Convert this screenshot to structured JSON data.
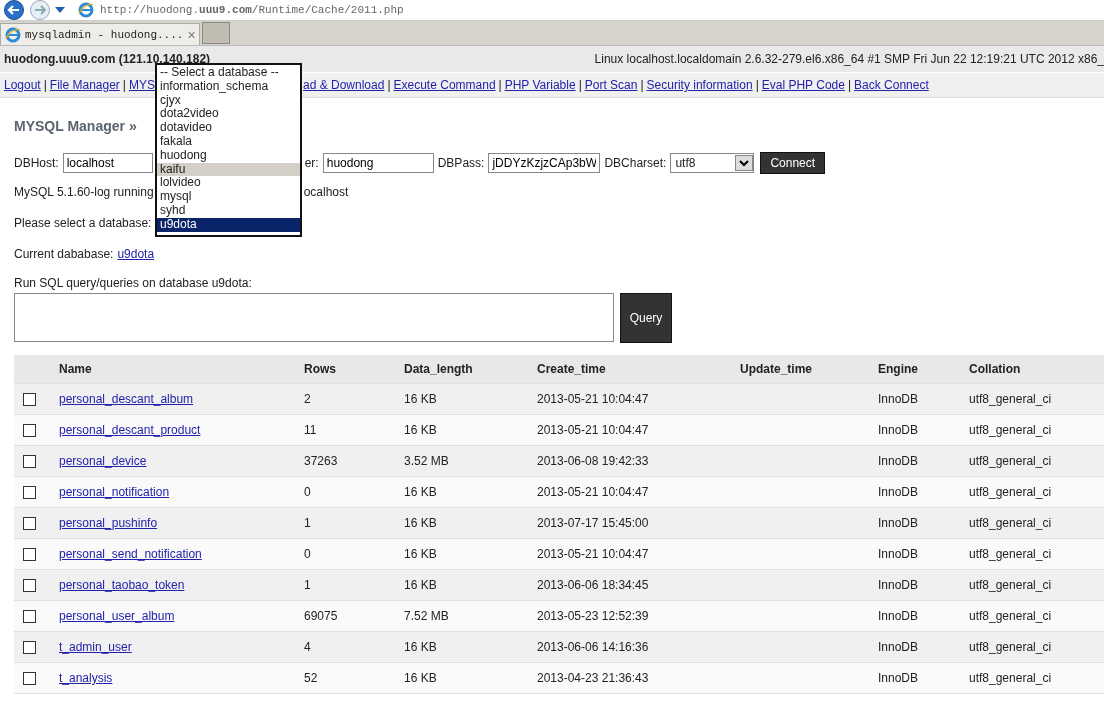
{
  "browser": {
    "url": "http://huodong.**uuu9.com**/Runtime/Cache/2011.php",
    "tab_title": "mysqladmin - huodong....",
    "tab_close": "×"
  },
  "header": {
    "host": "huodong.uuu9.com (121.10.140.182)",
    "system": "Linux localhost.localdomain 2.6.32-279.el6.x86_64 #1 SMP Fri Jun 22 12:19:21 UTC 2012 x86_"
  },
  "nav": [
    {
      "kind": "link",
      "label": "Logout"
    },
    {
      "kind": "separator",
      "label": "|"
    },
    {
      "kind": "link",
      "label": "File Manager"
    },
    {
      "kind": "separator",
      "label": "|"
    },
    {
      "kind": "link",
      "label": "MYS"
    },
    {
      "kind": "covered"
    },
    {
      "kind": "link",
      "label": "ad & Download"
    },
    {
      "kind": "separator",
      "label": "|"
    },
    {
      "kind": "link",
      "label": "Execute Command"
    },
    {
      "kind": "separator",
      "label": "|"
    },
    {
      "kind": "link",
      "label": "PHP Variable"
    },
    {
      "kind": "separator",
      "label": "|"
    },
    {
      "kind": "link",
      "label": "Port Scan"
    },
    {
      "kind": "separator",
      "label": "|"
    },
    {
      "kind": "link",
      "label": "Security information"
    },
    {
      "kind": "separator",
      "label": "|"
    },
    {
      "kind": "link",
      "label": "Eval PHP Code"
    },
    {
      "kind": "separator",
      "label": "|"
    },
    {
      "kind": "link",
      "label": "Back Connect"
    }
  ],
  "title": "MYSQL Manager »",
  "connect": {
    "host_label": "DBHost:",
    "host": "localhost",
    "user_label": "er:",
    "user": "huodong",
    "pass_label": "DBPass:",
    "pass": "jDDYzKzjzCAp3bW",
    "charset_label": "DBCharset:",
    "charset": "utf8",
    "button": "Connect"
  },
  "server_info": {
    "left": "MySQL 5.1.60-log running",
    "right": "ocalhost"
  },
  "select_label": "Please select a database:",
  "current": {
    "label": "Current dababase:",
    "database": "u9dota"
  },
  "query": {
    "label": "Run SQL query/queries on database u9dota:",
    "button": "Query"
  },
  "database_dropdown": [
    {
      "label": "-- Select a database --",
      "selected": false,
      "hovered": false
    },
    {
      "label": "information_schema",
      "selected": false,
      "hovered": false
    },
    {
      "label": "cjyx",
      "selected": false,
      "hovered": false
    },
    {
      "label": "dota2video",
      "selected": false,
      "hovered": false
    },
    {
      "label": "dotavideo",
      "selected": false,
      "hovered": false
    },
    {
      "label": "fakala",
      "selected": false,
      "hovered": false
    },
    {
      "label": "huodong",
      "selected": false,
      "hovered": false
    },
    {
      "label": "kaifu",
      "selected": false,
      "hovered": true
    },
    {
      "label": "lolvideo",
      "selected": false,
      "hovered": false
    },
    {
      "label": "mysql",
      "selected": false,
      "hovered": false
    },
    {
      "label": "syhd",
      "selected": false,
      "hovered": false
    },
    {
      "label": "u9dota",
      "selected": true,
      "hovered": false
    }
  ],
  "table": {
    "columns": [
      "Name",
      "Rows",
      "Data_length",
      "Create_time",
      "Update_time",
      "Engine",
      "Collation"
    ],
    "rows": [
      {
        "checked": false,
        "name": "personal_descant_album",
        "rows": "2",
        "data_length": "16 KB",
        "create_time": "2013-05-21 10:04:47",
        "engine": "InnoDB",
        "collation": "utf8_general_ci"
      },
      {
        "checked": false,
        "name": "personal_descant_product",
        "rows": "11",
        "data_length": "16 KB",
        "create_time": "2013-05-21 10:04:47",
        "engine": "InnoDB",
        "collation": "utf8_general_ci"
      },
      {
        "checked": false,
        "name": "personal_device",
        "rows": "37263",
        "data_length": "3.52 MB",
        "create_time": "2013-06-08 19:42:33",
        "engine": "InnoDB",
        "collation": "utf8_general_ci"
      },
      {
        "checked": false,
        "name": "personal_notification",
        "rows": "0",
        "data_length": "16 KB",
        "create_time": "2013-05-21 10:04:47",
        "engine": "InnoDB",
        "collation": "utf8_general_ci"
      },
      {
        "checked": false,
        "name": "personal_pushinfo",
        "rows": "1",
        "data_length": "16 KB",
        "create_time": "2013-07-17 15:45:00",
        "engine": "InnoDB",
        "collation": "utf8_general_ci"
      },
      {
        "checked": false,
        "name": "personal_send_notification",
        "rows": "0",
        "data_length": "16 KB",
        "create_time": "2013-05-21 10:04:47",
        "engine": "InnoDB",
        "collation": "utf8_general_ci"
      },
      {
        "checked": false,
        "name": "personal_taobao_token",
        "rows": "1",
        "data_length": "16 KB",
        "create_time": "2013-06-06 18:34:45",
        "engine": "InnoDB",
        "collation": "utf8_general_ci"
      },
      {
        "checked": false,
        "name": "personal_user_album",
        "rows": "69075",
        "data_length": "7.52 MB",
        "create_time": "2013-05-23 12:52:39",
        "engine": "InnoDB",
        "collation": "utf8_general_ci"
      },
      {
        "checked": false,
        "name": "t_admin_user",
        "rows": "4",
        "data_length": "16 KB",
        "create_time": "2013-06-06 14:16:36",
        "engine": "InnoDB",
        "collation": "utf8_general_ci"
      },
      {
        "checked": false,
        "name": "t_analysis",
        "rows": "52",
        "data_length": "16 KB",
        "create_time": "2013-04-23 21:36:43",
        "engine": "InnoDB",
        "collation": "utf8_general_ci"
      }
    ]
  }
}
